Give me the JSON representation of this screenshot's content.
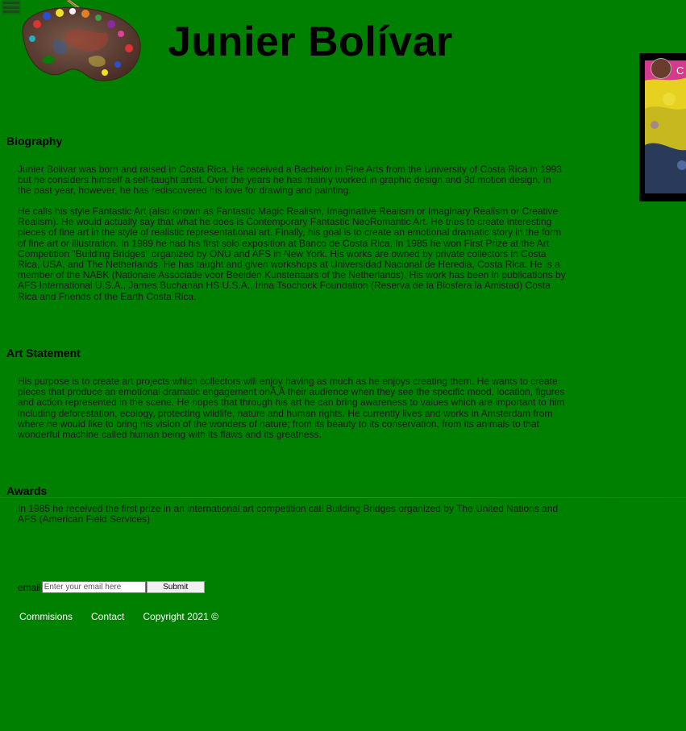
{
  "header": {
    "menu_label": "menu",
    "title": "Junier Bolívar"
  },
  "biography": {
    "heading": "Biography",
    "paragraphs": [
      "Junier Bolivar was born and raised in Costa Rica. He received a Bachelor in Fine Arts from the University of Costa Rica in 1993 but he considers himself a self-taught artist. Over the years he has mainly worked in graphic design and 3d motion design. In the past year, however, he has rediscovered his love for drawing and painting.",
      "He calls his style Fantastic Art (also known as Fantastic Magic Realism, Imaginative Realism or Imaginary Realism or Creative Realism). He would actually say that what he does is Contemporary Fantastic NeoRomantic Art. He tries to create interesting pieces of fine art in the style of realistic representational art. Finally, his goal is to create an emotional dramatic story in the form of fine art or illustration. In 1989 he had his first solo exposition at Banco de Costa Rica. In 1985 he won First Prize at the Art Competition \"Building Bridges\" organized by ONU and AFS in New York. His works are owned by private collectors in Costa Rica, USA, and The Netherlands. He has taught and given workshops at Universidad Nacional de Heredia, Costa Rica. He is a member of the NABK (Nationale Associatie voor Beelden Kunstenaars of the Netherlands). His work has been in publications by AFS International U.S.A., James Buchanan HS U.S.A., Irina Tsochock Foundation (Reserva de la Biosfera la Amistad) Costa Rica and Friends of the Earth Costa Rica."
    ]
  },
  "art_statement": {
    "heading": "Art Statement",
    "text": "His purpose is to create art projects which collectors will enjoy having as much as he enjoys creating them. He wants to create pieces that produce an emotional dramatic engagement onÃ‚Â their audience when they see the specific mood, location, figures and action represented in the scene. He hopes that through his art he can bring awareness to values which are important to him including deforestation, ecology, protecting wildlife, nature and human rights. He currently lives and works in Amsterdam from where he would like to bring his vision of the wonders of nature; from its beauty to its conservation, from its animals to that wonderful machine called human being with its flaws and its greatness."
  },
  "awards": {
    "heading": "Awards",
    "text": "In 1985 he received the first prize in an international art competition call Building Bridges organized by The United Nations and AFS (American Field Services)"
  },
  "video": {
    "channel_initial": "C"
  },
  "subscribe": {
    "label": "email",
    "placeholder": "Enter your email here",
    "button": "Submit"
  },
  "footer": {
    "commissions": "Commisions",
    "contact": "Contact",
    "copyright": "Copyright 2021 ©"
  },
  "colors": {
    "background": "#008000",
    "footer_text": "#ffffff"
  },
  "icons": [
    "hamburger-menu-icon",
    "paint-palette-logo"
  ]
}
